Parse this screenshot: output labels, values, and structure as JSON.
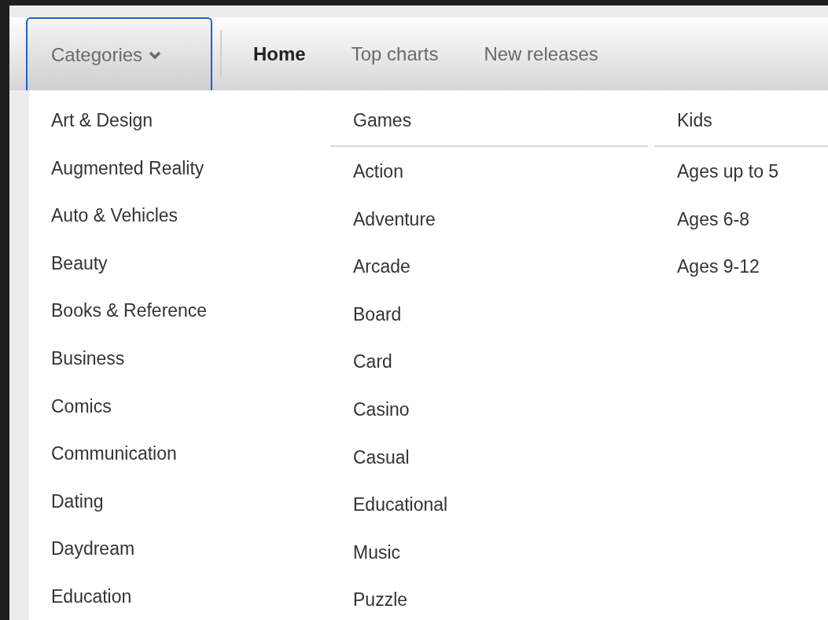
{
  "nav": {
    "categories": {
      "label": "Categories",
      "expanded": true
    },
    "tabs": [
      {
        "label": "Home",
        "selected": true
      },
      {
        "label": "Top charts",
        "selected": false
      },
      {
        "label": "New releases",
        "selected": false
      }
    ]
  },
  "menu": {
    "categories": [
      "Art & Design",
      "Augmented Reality",
      "Auto & Vehicles",
      "Beauty",
      "Books & Reference",
      "Business",
      "Comics",
      "Communication",
      "Dating",
      "Daydream",
      "Education"
    ],
    "groups": [
      {
        "title": "Games",
        "items": [
          "Action",
          "Adventure",
          "Arcade",
          "Board",
          "Card",
          "Casino",
          "Casual",
          "Educational",
          "Music",
          "Puzzle"
        ]
      },
      {
        "title": "Kids",
        "items": [
          "Ages up to 5",
          "Ages 6-8",
          "Ages 9-12"
        ]
      }
    ]
  }
}
